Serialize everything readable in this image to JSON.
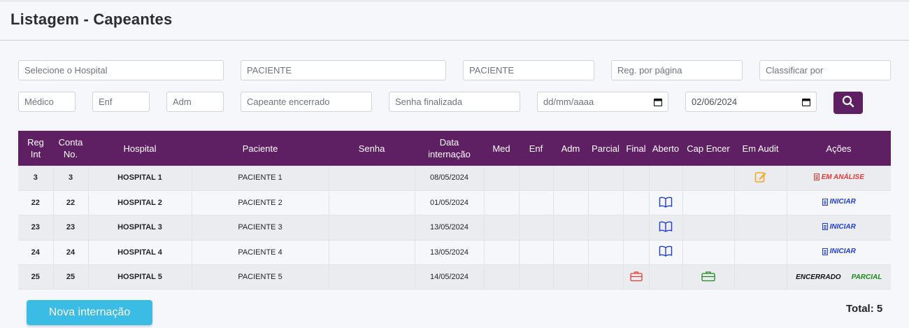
{
  "page": {
    "title": "Listagem - Capeantes"
  },
  "filters": {
    "hospital": "Selecione o Hospital",
    "paciente1": "PACIENTE",
    "paciente2": "PACIENTE",
    "reg_por_pagina": "Reg. por página",
    "classificar": "Classificar por",
    "medico": "Médico",
    "enf": "Enf",
    "adm": "Adm",
    "capeante_encerrado": "Capeante encerrado",
    "senha_finalizada": "Senha finalizada",
    "date_from": "dd/mm/aaaa",
    "date_to": "02/06/2024"
  },
  "table": {
    "headers": {
      "reg_int_1": "Reg",
      "reg_int_2": "Int",
      "conta_1": "Conta",
      "conta_2": "No.",
      "hospital": "Hospital",
      "paciente": "Paciente",
      "senha": "Senha",
      "data_1": "Data",
      "data_2": "internação",
      "med": "Med",
      "enf": "Enf",
      "adm": "Adm",
      "parcial": "Parcial",
      "final": "Final",
      "aberto": "Aberto",
      "cap_encer": "Cap Encer",
      "em_audit": "Em Audit",
      "acoes": "Ações"
    },
    "rows": [
      {
        "reg": "3",
        "conta": "3",
        "hospital": "HOSPITAL 1",
        "paciente": "PACIENTE 1",
        "senha": "",
        "data": "08/05/2024",
        "action": "EM ANÁLISE"
      },
      {
        "reg": "22",
        "conta": "22",
        "hospital": "HOSPITAL 2",
        "paciente": "PACIENTE 2",
        "senha": "",
        "data": "01/05/2024",
        "action": "INICIAR"
      },
      {
        "reg": "23",
        "conta": "23",
        "hospital": "HOSPITAL 3",
        "paciente": "PACIENTE 3",
        "senha": "",
        "data": "13/05/2024",
        "action": "INICIAR"
      },
      {
        "reg": "24",
        "conta": "24",
        "hospital": "HOSPITAL 4",
        "paciente": "PACIENTE 4",
        "senha": "",
        "data": "13/05/2024",
        "action": "INICIAR"
      },
      {
        "reg": "25",
        "conta": "25",
        "hospital": "HOSPITAL 5",
        "paciente": "PACIENTE 5",
        "senha": "",
        "data": "14/05/2024",
        "action": "ENCERRADO",
        "action2": "PARCIAL"
      }
    ]
  },
  "footer": {
    "nova_label": "Nova internação",
    "total": "Total: 5"
  },
  "colors": {
    "primary": "#5e1f63",
    "accent": "#3bbce5",
    "danger": "#e53935",
    "link": "#1f3bd6",
    "success": "#1c8a1c",
    "warning": "#f5a623"
  }
}
